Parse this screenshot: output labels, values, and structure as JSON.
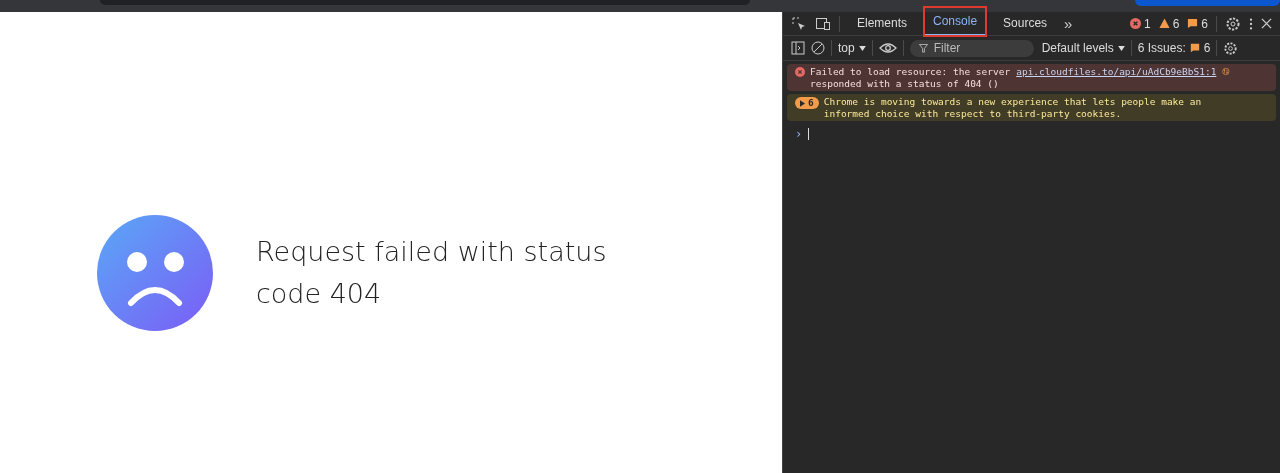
{
  "page": {
    "message": "Request failed with status code 404"
  },
  "devtools": {
    "tabs": [
      {
        "label": "Elements",
        "selected": false,
        "highlighted": false
      },
      {
        "label": "Console",
        "selected": true,
        "highlighted": true
      },
      {
        "label": "Sources",
        "selected": false,
        "highlighted": false
      }
    ],
    "more_tabs": "»",
    "counts": [
      {
        "kind": "error",
        "value": "1"
      },
      {
        "kind": "warning",
        "value": "6"
      },
      {
        "kind": "issue",
        "value": "6"
      }
    ],
    "context": "top",
    "filter": {
      "placeholder": "Filter"
    },
    "levels": "Default levels",
    "issues": {
      "label": "6 Issues:",
      "value": "6"
    },
    "messages": [
      {
        "kind": "error",
        "text": "Failed to load resource: the server",
        "link": "api.cloudfiles.to/api/uAdCb9eBbS1:1",
        "text2": "responded with a status of 404 ()"
      },
      {
        "kind": "warning",
        "count": "6",
        "text": "Chrome is moving towards a new experience that lets people make an informed choice with respect to third-party cookies."
      }
    ],
    "prompt": "›"
  }
}
